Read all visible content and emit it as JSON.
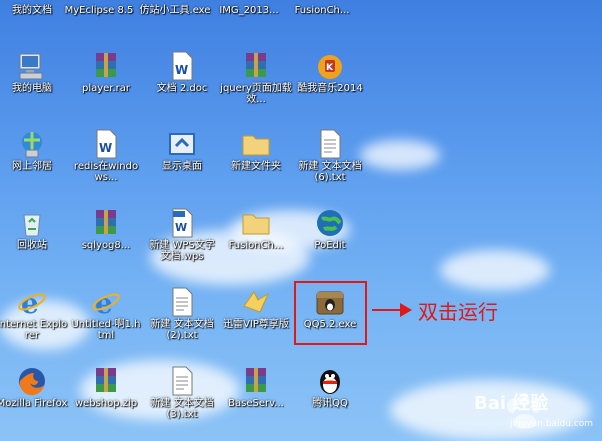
{
  "top_row": [
    "我的文档",
    "MyEclipse 8.5",
    "仿站小工具.exe",
    "IMG_2013...",
    "FusionCh..."
  ],
  "icons": [
    {
      "label": "我的电脑",
      "icon": "computer-icon"
    },
    {
      "label": "player.rar",
      "icon": "winrar-archive-icon"
    },
    {
      "label": "文档 2.doc",
      "icon": "word-document-icon"
    },
    {
      "label": "jquery页面加载效...",
      "icon": "winrar-archive-icon"
    },
    {
      "label": "酷我音乐2014",
      "icon": "kuwo-music-icon"
    },
    {
      "label": "网上邻居",
      "icon": "network-places-icon"
    },
    {
      "label": "redis在windows...",
      "icon": "word-document-icon"
    },
    {
      "label": "显示桌面",
      "icon": "show-desktop-icon"
    },
    {
      "label": "新建文件夹",
      "icon": "folder-icon"
    },
    {
      "label": "新建 文本文档 (6).txt",
      "icon": "text-file-icon"
    },
    {
      "label": "回收站",
      "icon": "recycle-bin-icon"
    },
    {
      "label": "sqlyog8...",
      "icon": "winrar-archive-icon"
    },
    {
      "label": "新建 WPS文字 文档.wps",
      "icon": "wps-document-icon"
    },
    {
      "label": "FusionCh...",
      "icon": "folder-icon"
    },
    {
      "label": "PoEdit",
      "icon": "poedit-globe-icon"
    },
    {
      "label": "Internet Explorer",
      "icon": "internet-explorer-icon"
    },
    {
      "label": "Untitled-啊1.html",
      "icon": "internet-explorer-icon"
    },
    {
      "label": "新建 文本文档 (2).txt",
      "icon": "text-file-icon"
    },
    {
      "label": "迅雷VIP尊享版",
      "icon": "thunder-bird-icon"
    },
    {
      "label": "QQ5.2.exe",
      "icon": "qq-installer-icon"
    },
    {
      "label": "Mozilla Firefox",
      "icon": "firefox-icon"
    },
    {
      "label": "webshop.zip",
      "icon": "winrar-archive-icon"
    },
    {
      "label": "新建 文本文档 (3).txt",
      "icon": "text-file-icon"
    },
    {
      "label": "BaseServ...",
      "icon": "winrar-archive-icon"
    },
    {
      "label": "腾讯QQ",
      "icon": "qq-penguin-icon"
    }
  ],
  "annotation": {
    "text": "双击运行",
    "color": "#e01818"
  },
  "watermark": {
    "brand": "Bai 经验",
    "url": "jingyan.baidu.com"
  }
}
